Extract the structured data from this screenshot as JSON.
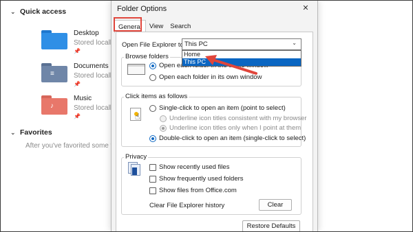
{
  "explorer": {
    "quick_access": {
      "title": "Quick access",
      "items": [
        {
          "name": "Desktop",
          "sub": "Stored locall",
          "icon": "desktop-folder-icon",
          "color": "#2f8fe6"
        },
        {
          "name": "Documents",
          "sub": "Stored locall",
          "icon": "documents-folder-icon",
          "color": "#6f86a8"
        },
        {
          "name": "Music",
          "sub": "Stored locall",
          "icon": "music-folder-icon",
          "color": "#e8776a"
        }
      ],
      "pin_glyph": "📌"
    },
    "favorites": {
      "title": "Favorites",
      "hint": "After you've favorited some fi"
    },
    "chevron": "⌄"
  },
  "dialog": {
    "title": "Folder Options",
    "close_glyph": "✕",
    "tabs": [
      "General",
      "View",
      "Search"
    ],
    "open_explorer_label": "Open File Explorer to:",
    "open_explorer_value": "This PC",
    "dropdown_options": [
      "Home",
      "This PC"
    ],
    "dropdown_selected": "This PC",
    "accent": "#0a66c2",
    "highlight": "#e0453b",
    "browse": {
      "title": "Browse folders",
      "options": [
        "Open each folder in the same window",
        "Open each folder in its own window"
      ]
    },
    "click": {
      "title": "Click items as follows",
      "single": "Single-click to open an item (point to select)",
      "underline_browser": "Underline icon titles consistent with my browser",
      "underline_point": "Underline icon titles only when I point at them",
      "double": "Double-click to open an item (single-click to select)"
    },
    "privacy": {
      "title": "Privacy",
      "recent": "Show recently used files",
      "frequent": "Show frequently used folders",
      "office": "Show files from Office.com",
      "clear_label": "Clear File Explorer history",
      "clear_button": "Clear"
    },
    "restore_button": "Restore Defaults"
  }
}
